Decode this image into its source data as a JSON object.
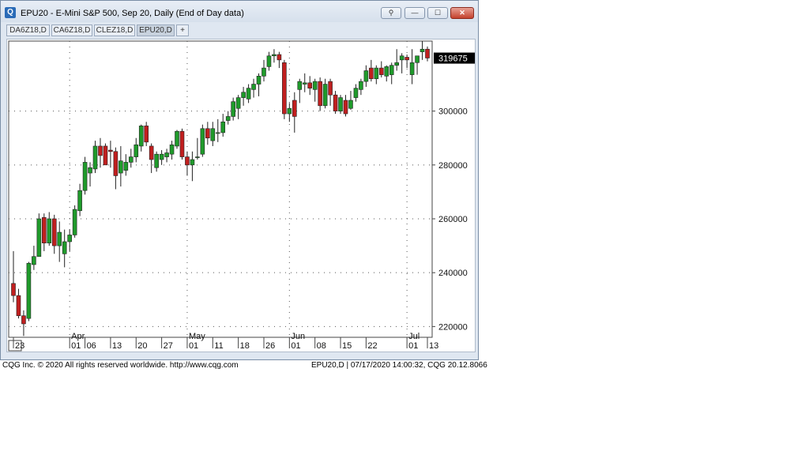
{
  "window": {
    "title": "EPU20 - E-Mini S&P 500, Sep 20, Daily (End of Day data)",
    "app_icon": "Q"
  },
  "titlebar_buttons": [
    {
      "name": "link-icon",
      "glyph": "⚲"
    },
    {
      "name": "minimize-icon",
      "glyph": "—"
    },
    {
      "name": "maximize-icon",
      "glyph": "☐"
    },
    {
      "name": "close-icon",
      "glyph": "✕"
    }
  ],
  "tabs": [
    {
      "label": "DA6Z18,D"
    },
    {
      "label": "CA6Z18,D"
    },
    {
      "label": "CLEZ18,D"
    },
    {
      "label": "EPU20,D",
      "active": true
    },
    {
      "label": "+"
    }
  ],
  "chart_data": {
    "type": "candlestick",
    "y_axis": {
      "ticks": [
        "220000",
        "240000",
        "260000",
        "280000",
        "300000"
      ],
      "range": [
        216000,
        326000
      ],
      "position": "right"
    },
    "x_axis": {
      "months": [
        "Apr",
        "May",
        "Jun",
        "Jul"
      ],
      "day_labels": [
        "23",
        "01",
        "06",
        "13",
        "20",
        "27",
        "01",
        "11",
        "18",
        "26",
        "01",
        "08",
        "15",
        "22",
        "01",
        "13"
      ]
    },
    "last_price_label": "319675",
    "grid": "dotted",
    "colors": {
      "up": "#1f9b2b",
      "down": "#c11f1f",
      "last_price_bg": "#000000"
    },
    "candles": [
      [
        236000,
        248000,
        229000,
        231500
      ],
      [
        231500,
        234000,
        223000,
        224000
      ],
      [
        224000,
        226000,
        216500,
        221000
      ],
      [
        223000,
        244000,
        222000,
        243500
      ],
      [
        243000,
        250000,
        241000,
        246000
      ],
      [
        246000,
        262000,
        246000,
        260000
      ],
      [
        260500,
        262000,
        248000,
        251000
      ],
      [
        251000,
        262500,
        250000,
        260000
      ],
      [
        260000,
        261500,
        247000,
        250000
      ],
      [
        250000,
        259000,
        244000,
        255000
      ],
      [
        247000,
        256000,
        242000,
        251500
      ],
      [
        251500,
        256000,
        248000,
        254000
      ],
      [
        254000,
        265000,
        253000,
        263500
      ],
      [
        263000,
        273000,
        261000,
        270500
      ],
      [
        270500,
        283000,
        269000,
        281000
      ],
      [
        277000,
        281000,
        272000,
        279000
      ],
      [
        278500,
        289000,
        277000,
        287000
      ],
      [
        287000,
        290000,
        279000,
        283500
      ],
      [
        287000,
        288000,
        283000,
        280000
      ],
      [
        285500,
        289000,
        279000,
        285000
      ],
      [
        285000,
        286500,
        271000,
        276000
      ],
      [
        277000,
        287000,
        272000,
        281500
      ],
      [
        278000,
        284000,
        276000,
        281000
      ],
      [
        281000,
        286000,
        279000,
        283000
      ],
      [
        283000,
        290000,
        281000,
        287500
      ],
      [
        287000,
        295000,
        285000,
        294500
      ],
      [
        294500,
        296000,
        287000,
        288500
      ],
      [
        287000,
        288000,
        277000,
        282000
      ],
      [
        279000,
        285000,
        277500,
        284000
      ],
      [
        282000,
        285500,
        280000,
        284000
      ],
      [
        283000,
        286000,
        281000,
        284500
      ],
      [
        284000,
        289000,
        282000,
        287500
      ],
      [
        287000,
        293000,
        286000,
        292500
      ],
      [
        292500,
        293500,
        282000,
        283000
      ],
      [
        283000,
        285000,
        276000,
        280000
      ],
      [
        280000,
        285000,
        274000,
        282000
      ],
      [
        283000,
        290000,
        282000,
        283000
      ],
      [
        284000,
        295000,
        283000,
        293500
      ],
      [
        293500,
        296000,
        287500,
        290000
      ],
      [
        289000,
        296000,
        287000,
        293500
      ],
      [
        292000,
        297000,
        288500,
        292000
      ],
      [
        292000,
        299000,
        290500,
        296000
      ],
      [
        296500,
        300000,
        295000,
        298000
      ],
      [
        298000,
        305000,
        296500,
        303500
      ],
      [
        301000,
        306000,
        297000,
        305000
      ],
      [
        305000,
        309000,
        302000,
        307000
      ],
      [
        304500,
        310000,
        303000,
        308500
      ],
      [
        308000,
        312000,
        305000,
        310000
      ],
      [
        310000,
        314000,
        305500,
        313000
      ],
      [
        313000,
        319000,
        311000,
        316000
      ],
      [
        316500,
        322000,
        315000,
        320500
      ],
      [
        320500,
        323000,
        318000,
        321000
      ],
      [
        321000,
        322000,
        316000,
        319000
      ],
      [
        318000,
        319000,
        297000,
        299000
      ],
      [
        299000,
        303000,
        296000,
        301000
      ],
      [
        304000,
        307000,
        292000,
        298000
      ],
      [
        308000,
        312000,
        303000,
        311000
      ],
      [
        310000,
        314000,
        307000,
        310500
      ],
      [
        310500,
        313000,
        306000,
        308500
      ],
      [
        308000,
        312000,
        303500,
        311000
      ],
      [
        311000,
        312500,
        300000,
        302000
      ],
      [
        302000,
        312000,
        301000,
        310000
      ],
      [
        311000,
        312000,
        302000,
        306000
      ],
      [
        306000,
        307500,
        299000,
        300000
      ],
      [
        300000,
        306000,
        299000,
        305000
      ],
      [
        304000,
        306000,
        298000,
        299000
      ],
      [
        301000,
        307500,
        300500,
        304000
      ],
      [
        305000,
        310000,
        303500,
        308500
      ],
      [
        308000,
        312000,
        306000,
        311000
      ],
      [
        311000,
        317000,
        309000,
        315000
      ],
      [
        316000,
        319000,
        311000,
        312000
      ],
      [
        312000,
        317000,
        310000,
        316000
      ],
      [
        316000,
        318500,
        312500,
        313500
      ],
      [
        313000,
        317000,
        311000,
        316500
      ],
      [
        313500,
        318000,
        310000,
        317000
      ],
      [
        317000,
        323000,
        315000,
        318000
      ],
      [
        319000,
        321500,
        314000,
        320500
      ],
      [
        320000,
        321000,
        316000,
        319000
      ],
      [
        313500,
        323000,
        310000,
        318000
      ],
      [
        318000,
        320000,
        313500,
        320500
      ],
      [
        322000,
        326000,
        319000,
        323000
      ],
      [
        323000,
        324000,
        318500,
        319700
      ]
    ]
  },
  "footer": {
    "left": "CQG Inc. © 2020 All rights reserved worldwide. http://www.cqg.com",
    "right": "EPU20,D | 07/17/2020 14:00:32, CQG 20.12.8066"
  }
}
